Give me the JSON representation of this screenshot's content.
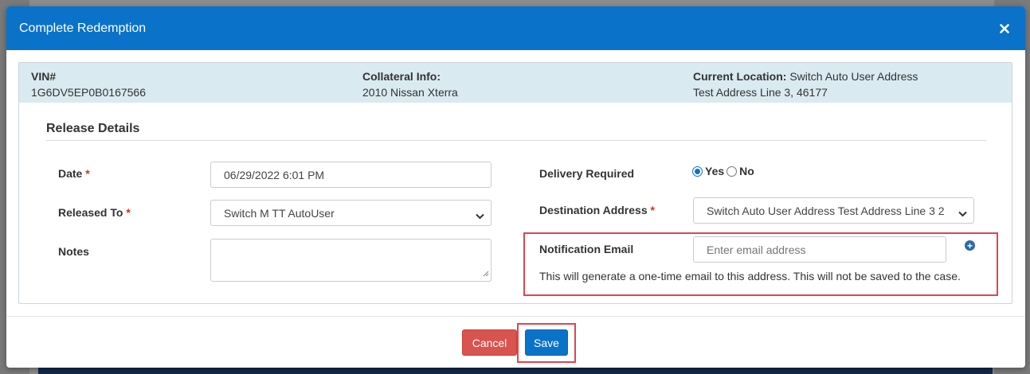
{
  "modal": {
    "title": "Complete Redemption",
    "close_icon": "close-icon"
  },
  "info": {
    "vin_label": "VIN#",
    "vin_value": "1G6DV5EP0B0167566",
    "collateral_label": "Collateral Info:",
    "collateral_value": "2010 Nissan Xterra",
    "location_label": "Current Location:",
    "location_value_line1": "Switch Auto User Address",
    "location_value_line2": "Test Address Line 3, 46177"
  },
  "release": {
    "section_title": "Release Details",
    "date_label": "Date",
    "date_value": "06/29/2022 6:01 PM",
    "released_to_label": "Released To",
    "released_to_value": "Switch M TT AutoUser",
    "notes_label": "Notes",
    "notes_value": "",
    "required_marker": "*",
    "delivery_label": "Delivery Required",
    "delivery_yes": "Yes",
    "delivery_no": "No",
    "delivery_selected": "Yes",
    "destination_label": "Destination Address",
    "destination_value": "Switch Auto User Address Test Address Line 3 2",
    "notification_label": "Notification Email",
    "notification_placeholder": "Enter email address",
    "notification_help": "This will generate a one-time email to this address. This will not be saved to the case."
  },
  "footer": {
    "cancel_label": "Cancel",
    "save_label": "Save"
  },
  "colors": {
    "header": "#0b72c9",
    "info_bar": "#daeaf1",
    "cancel": "#d9534f",
    "save": "#0b72c9",
    "highlight": "#e0444f"
  }
}
